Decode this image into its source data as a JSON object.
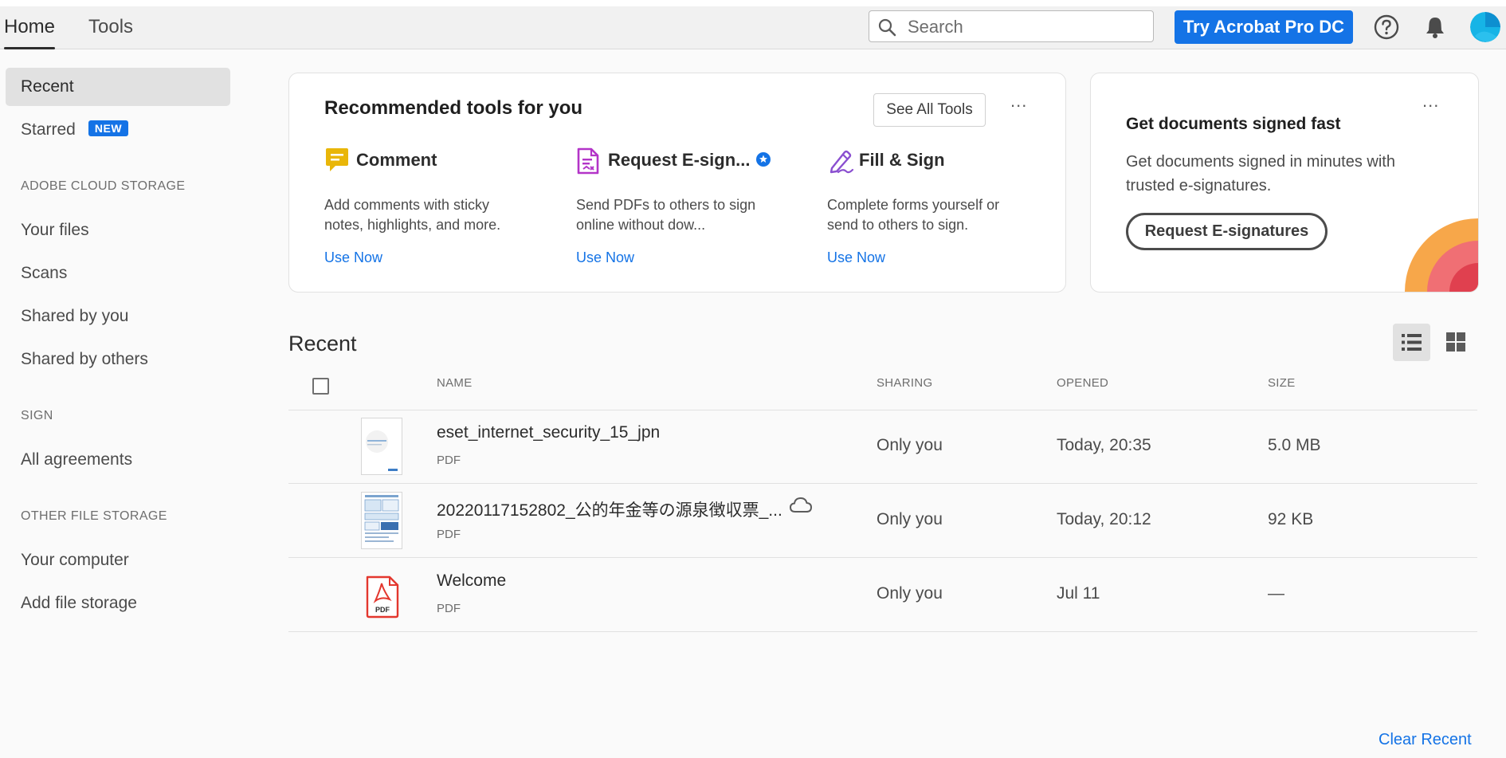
{
  "topbar": {
    "tabs": [
      {
        "label": "Home"
      },
      {
        "label": "Tools"
      }
    ],
    "search_placeholder": "Search",
    "try_pro_label": "Try Acrobat Pro DC"
  },
  "sidebar": {
    "recent": "Recent",
    "starred": "Starred",
    "new_badge": "NEW",
    "cloud_heading": "ADOBE CLOUD STORAGE",
    "your_files": "Your files",
    "scans": "Scans",
    "shared_by_you": "Shared by you",
    "shared_by_others": "Shared by others",
    "sign_heading": "SIGN",
    "all_agreements": "All agreements",
    "other_heading": "OTHER FILE STORAGE",
    "your_computer": "Your computer",
    "add_file_storage": "Add file storage"
  },
  "tools_card": {
    "title": "Recommended tools for you",
    "see_all": "See All Tools",
    "more": "...",
    "tools": [
      {
        "name": "Comment",
        "desc": "Add comments with sticky notes, highlights, and more.",
        "link": "Use Now"
      },
      {
        "name": "Request E-sign...",
        "desc": "Send PDFs to others to sign online without dow...",
        "link": "Use Now"
      },
      {
        "name": "Fill & Sign",
        "desc": "Complete forms yourself or send to others to sign.",
        "link": "Use Now"
      }
    ]
  },
  "sign_card": {
    "title": "Get documents signed fast",
    "desc": "Get documents signed in minutes with trusted e-signatures.",
    "button": "Request E-signatures",
    "more": "..."
  },
  "recent": {
    "title": "Recent",
    "columns": {
      "name": "NAME",
      "sharing": "SHARING",
      "opened": "OPENED",
      "size": "SIZE"
    },
    "rows": [
      {
        "name": "eset_internet_security_15_jpn",
        "type": "PDF",
        "sharing": "Only you",
        "opened": "Today, 20:35",
        "size": "5.0 MB"
      },
      {
        "name": "20220117152802_公的年金等の源泉徴収票_...",
        "type": "PDF",
        "sharing": "Only you",
        "opened": "Today, 20:12",
        "size": "92 KB"
      },
      {
        "name": "Welcome",
        "type": "PDF",
        "sharing": "Only you",
        "opened": "Jul 11",
        "size": "—"
      }
    ],
    "clear_label": "Clear Recent"
  },
  "colors": {
    "accent": "#1473e6",
    "comment": "#e9b609",
    "esign": "#b334c8",
    "fillsign": "#8a4fd0",
    "pdf_red": "#e3372e"
  }
}
